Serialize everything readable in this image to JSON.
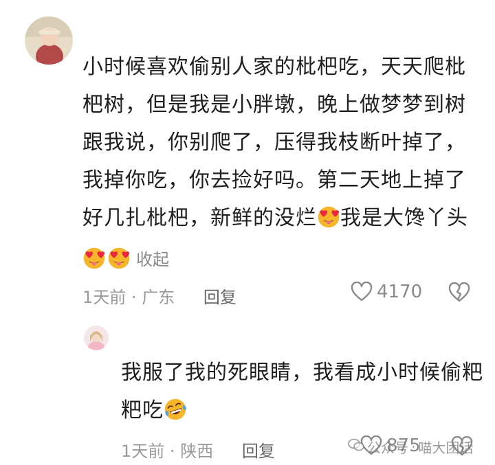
{
  "comment": {
    "lines": [
      "小时候喜欢偷别人家的枇杷吃，天天爬枇",
      "杷树，但是我是小胖墩，晚上做梦梦到树",
      "跟我说，你别爬了，压得我枝断叶掉了，",
      "我掉你吃，你去捡好吗。第二天地上掉了"
    ],
    "line5_before_emoji": "好几扎枇杷，新鲜的没烂",
    "line5_after_emoji": "我是大馋丫头",
    "emoji_name": "heart-eyes-tongue-emoji",
    "collapse_label": "收起",
    "time": "1天前",
    "separator": "·",
    "location": "广东",
    "reply_label": "回复",
    "like_count": "4170"
  },
  "reply": {
    "line1": "我服了我的死眼睛，我看成小时候偷粑",
    "line2_before_emoji": "粑吃",
    "emoji_name": "laughing-tears-emoji",
    "time": "1天前",
    "separator": "·",
    "location": "陕西",
    "reply_label": "回复",
    "like_count": "875"
  },
  "watermark": {
    "text_a": "公众号",
    "separator": "·",
    "text_b": "喵大团话"
  },
  "colors": {
    "text": "#1f1f1f",
    "meta": "#9a9a9a",
    "icon": "#8a8a8a",
    "emoji_face": "#f7b52c",
    "emoji_heart": "#e8293d"
  }
}
